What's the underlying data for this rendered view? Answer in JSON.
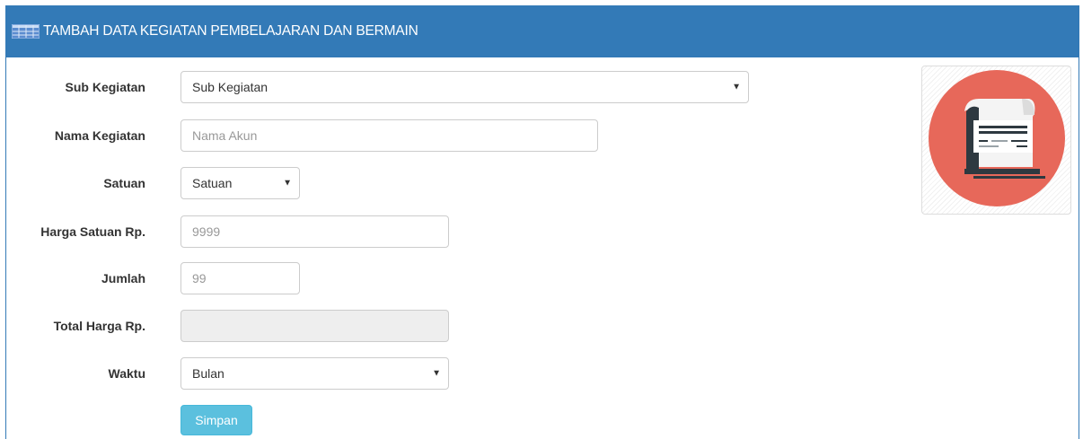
{
  "header": {
    "title": "TAMBAH DATA KEGIATAN PEMBELAJARAN DAN BERMAIN",
    "icon": "table-icon",
    "bg_color": "#337ab7"
  },
  "form": {
    "sub_kegiatan": {
      "label": "Sub Kegiatan",
      "selected": "Sub Kegiatan"
    },
    "nama_kegiatan": {
      "label": "Nama Kegiatan",
      "placeholder": "Nama Akun"
    },
    "satuan": {
      "label": "Satuan",
      "selected": "Satuan"
    },
    "harga_satuan": {
      "label": "Harga Satuan Rp.",
      "placeholder": "9999"
    },
    "jumlah": {
      "label": "Jumlah",
      "placeholder": "99"
    },
    "total_harga": {
      "label": "Total Harga Rp.",
      "value": ""
    },
    "waktu": {
      "label": "Waktu",
      "selected": "Bulan"
    },
    "submit_label": "Simpan"
  },
  "thumbnail": {
    "icon": "document-printer-icon",
    "circle_color": "#e7685a"
  }
}
